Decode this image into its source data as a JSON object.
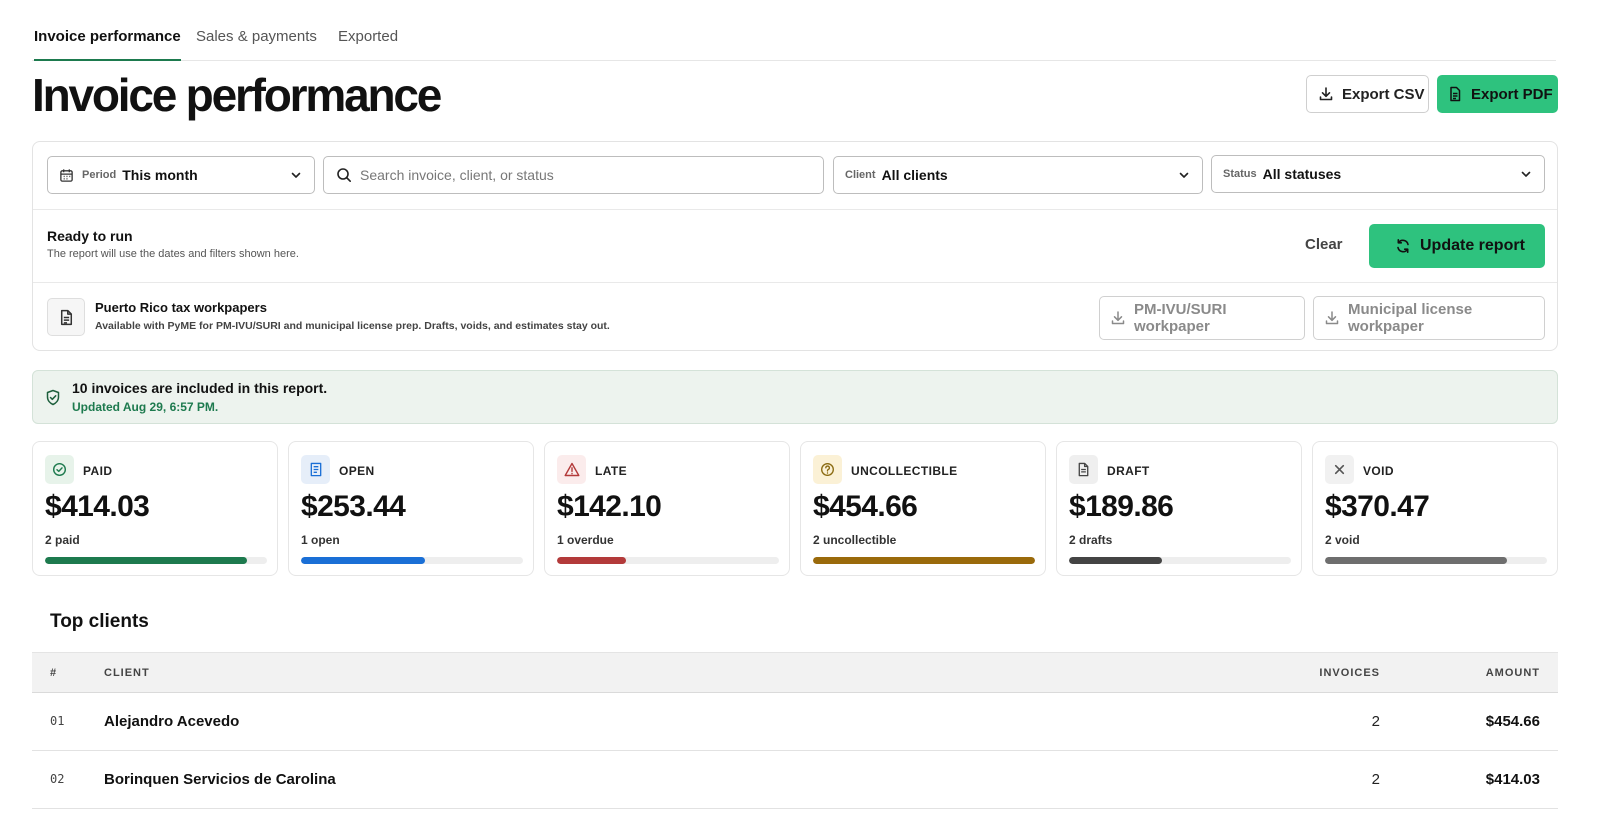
{
  "tabs": [
    {
      "label": "Invoice performance",
      "active": true
    },
    {
      "label": "Sales & payments",
      "active": false
    },
    {
      "label": "Exported",
      "active": false
    }
  ],
  "header": {
    "title": "Invoice performance",
    "export_csv": "Export CSV",
    "export_pdf": "Export PDF"
  },
  "filters": {
    "period": {
      "prefix": "Period",
      "value": "This month"
    },
    "search": {
      "placeholder": "Search invoice, client, or status"
    },
    "client": {
      "prefix": "Client",
      "value": "All clients"
    },
    "status": {
      "prefix": "Status",
      "value": "All statuses"
    }
  },
  "ready": {
    "title": "Ready to run",
    "subtitle": "The report will use the dates and filters shown here.",
    "clear": "Clear",
    "update": "Update report"
  },
  "tax": {
    "title": "Puerto Rico tax workpapers",
    "subtitle": "Available with PyME for PM-IVU/SURI and municipal license prep. Drafts, voids, and estimates stay out.",
    "button_1": "PM-IVU/SURI workpaper",
    "button_2": "Municipal license workpaper"
  },
  "banner": {
    "title": "10 invoices are included in this report.",
    "subtitle": "Updated Aug 29, 6:57 PM."
  },
  "stats": [
    {
      "label": "PAID",
      "amount": "$414.03",
      "sub": "2 paid",
      "fill": 0.91,
      "color": "#1d7a4e",
      "icon": "check-circle-icon",
      "icon_bg": "#e7f3ea",
      "icon_color": "#1d7a4e"
    },
    {
      "label": "OPEN",
      "amount": "$253.44",
      "sub": "1 open",
      "fill": 0.56,
      "color": "#1a6fd6",
      "icon": "document-icon",
      "icon_bg": "#e6eef9",
      "icon_color": "#1a6fd6"
    },
    {
      "label": "LATE",
      "amount": "$142.10",
      "sub": "1 overdue",
      "fill": 0.31,
      "color": "#b33a3a",
      "icon": "warning-icon",
      "icon_bg": "#fbecec",
      "icon_color": "#b33a3a"
    },
    {
      "label": "UNCOLLECTIBLE",
      "amount": "$454.66",
      "sub": "2 uncollectible",
      "fill": 1.0,
      "color": "#9a6a0b",
      "icon": "question-circle-icon",
      "icon_bg": "#fbf1d6",
      "icon_color": "#8a6a10"
    },
    {
      "label": "DRAFT",
      "amount": "$189.86",
      "sub": "2 drafts",
      "fill": 0.42,
      "color": "#444444",
      "icon": "draft-icon",
      "icon_bg": "#efefef",
      "icon_color": "#444444"
    },
    {
      "label": "VOID",
      "amount": "$370.47",
      "sub": "2 void",
      "fill": 0.82,
      "color": "#6e6e6e",
      "icon": "close-icon",
      "icon_bg": "#f1f1f1",
      "icon_color": "#555555"
    }
  ],
  "top_clients": {
    "title": "Top clients",
    "columns": {
      "num": "#",
      "client": "CLIENT",
      "invoices": "INVOICES",
      "amount": "AMOUNT"
    },
    "rows": [
      {
        "num": "01",
        "client": "Alejandro Acevedo",
        "invoices": "2",
        "amount": "$454.66"
      },
      {
        "num": "02",
        "client": "Borinquen Servicios de Carolina",
        "invoices": "2",
        "amount": "$414.03"
      }
    ]
  },
  "colors": {
    "accent": "#2ec27e",
    "accent_dark": "#1d7a4e",
    "banner_bg": "#edf3ee"
  }
}
